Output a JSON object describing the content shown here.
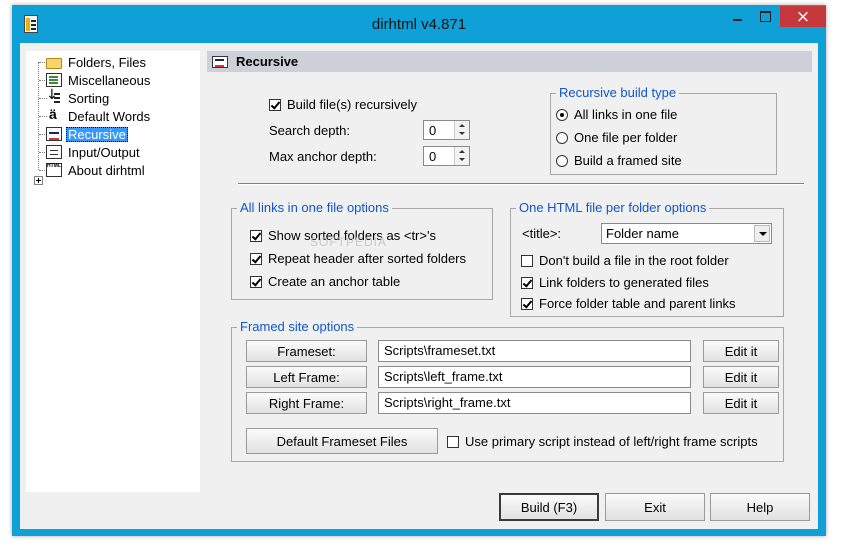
{
  "window": {
    "title": "dirhtml v4.871",
    "controls": {
      "minimize": "minimize",
      "maximize": "maximize",
      "close": "×"
    }
  },
  "sidebar": {
    "items": [
      {
        "label": "Folders, Files",
        "icon": "folder-icon"
      },
      {
        "label": "Miscellaneous",
        "icon": "list-icon"
      },
      {
        "label": "Sorting",
        "icon": "sort-icon"
      },
      {
        "label": "Default Words",
        "icon": "words-icon"
      },
      {
        "label": "Recursive",
        "icon": "recursive-icon",
        "selected": true
      },
      {
        "label": "Input/Output",
        "icon": "io-icon"
      },
      {
        "label": "About dirhtml",
        "icon": "html-icon"
      }
    ]
  },
  "panel": {
    "title": "Recursive",
    "build_recursively": {
      "label": "Build file(s) recursively",
      "checked": true
    },
    "search_depth": {
      "label": "Search depth:",
      "value": "0"
    },
    "max_anchor_depth": {
      "label": "Max anchor depth:",
      "value": "0"
    }
  },
  "build_type": {
    "legend": "Recursive build type",
    "options": [
      {
        "label": "All links in one file",
        "checked": true
      },
      {
        "label": "One file per folder",
        "checked": false
      },
      {
        "label": "Build a framed site",
        "checked": false
      }
    ]
  },
  "one_file_options": {
    "legend": "All links in one file options",
    "items": [
      {
        "label": "Show sorted folders as <tr>'s",
        "checked": true
      },
      {
        "label": "Repeat header after sorted folders",
        "checked": true
      },
      {
        "label": "Create an anchor table",
        "checked": true
      }
    ]
  },
  "per_folder_options": {
    "legend": "One HTML file per folder options",
    "title_label": "<title>:",
    "title_value": "Folder name",
    "items": [
      {
        "label": "Don't build a file in the root folder",
        "checked": false
      },
      {
        "label": "Link folders to generated files",
        "checked": true
      },
      {
        "label": "Force folder table and parent links",
        "checked": true
      }
    ]
  },
  "framed": {
    "legend": "Framed site options",
    "rows": [
      {
        "button": "Frameset:",
        "value": "Scripts\\frameset.txt",
        "edit": "Edit it"
      },
      {
        "button": "Left Frame:",
        "value": "Scripts\\left_frame.txt",
        "edit": "Edit it"
      },
      {
        "button": "Right Frame:",
        "value": "Scripts\\right_frame.txt",
        "edit": "Edit it"
      }
    ],
    "default_button": "Default Frameset Files",
    "primary_script": {
      "label": "Use primary script instead of left/right frame scripts",
      "checked": false
    }
  },
  "footer": {
    "build": "Build (F3)",
    "exit": "Exit",
    "help": "Help"
  },
  "watermark": "SOFTPEDIA",
  "colors": {
    "titlebar": "#0fa0d7",
    "selection": "#3399ff",
    "legend": "#1055cc",
    "close": "#c7383d"
  }
}
